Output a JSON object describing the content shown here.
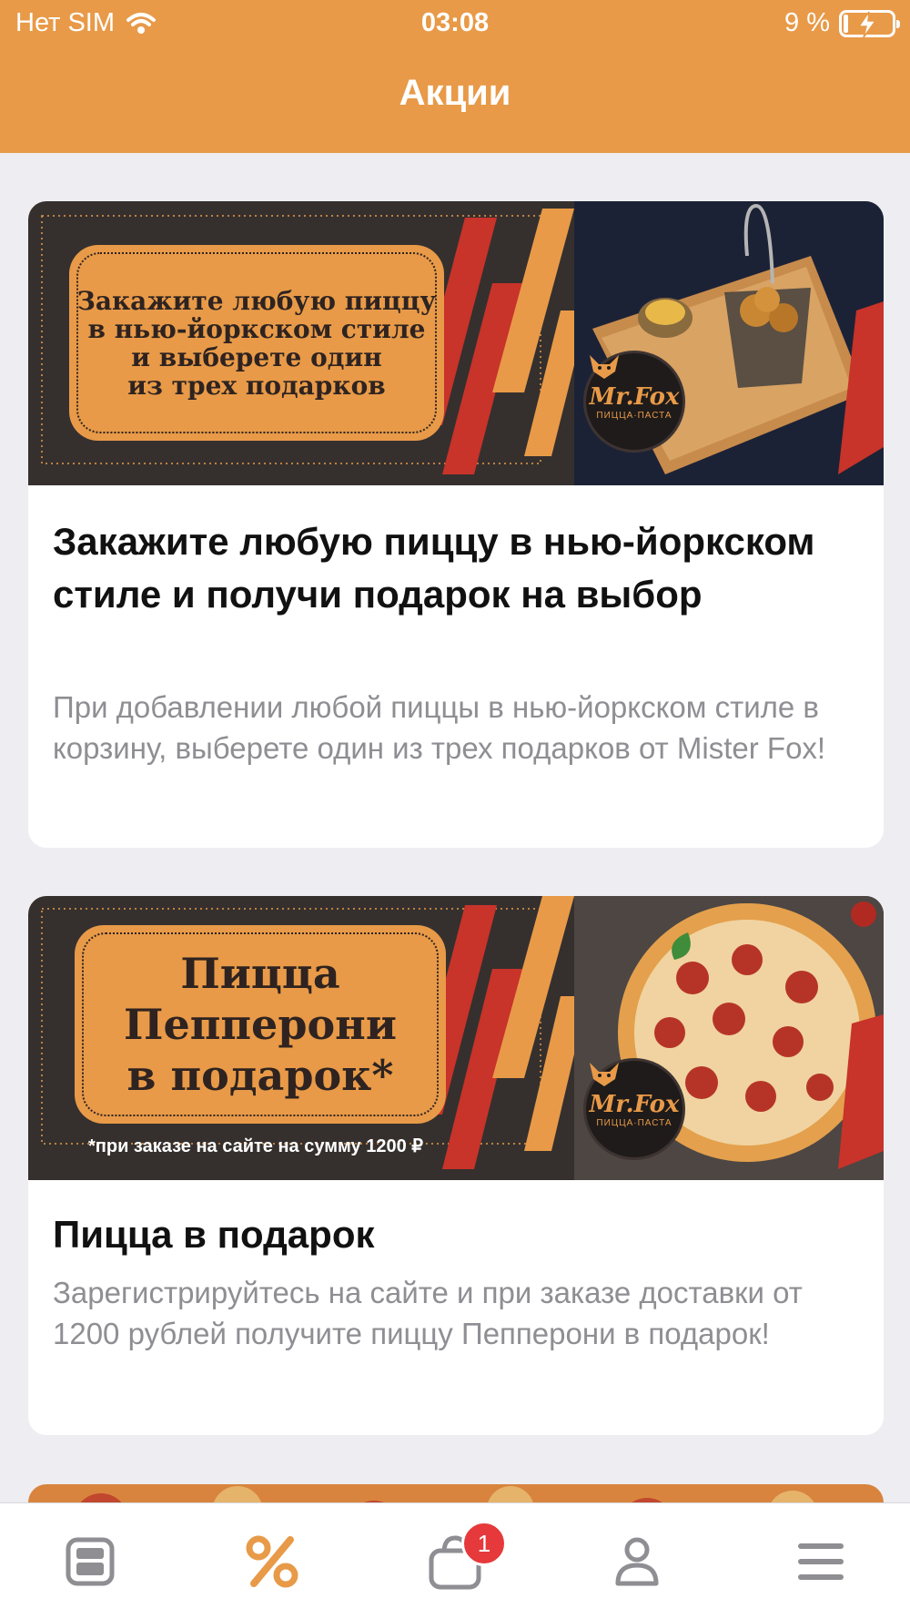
{
  "status_bar": {
    "carrier": "Нет SIM",
    "time": "03:08",
    "battery": "9 %"
  },
  "header": {
    "title": "Акции"
  },
  "promotions": [
    {
      "banner_text_lines": [
        "Закажите любую пиццу",
        "в нью-йоркском стиле",
        "и выберете один",
        "из трех подарков"
      ],
      "logo_text": "Mr.Fox",
      "logo_sub": "ПИЦЦА·ПАСТА",
      "title": "Закажите любую пиццу в нью-йоркском стиле и получи подарок на выбор",
      "description": "При добавлении любой пиццы в нью-йоркском стиле в корзину, выберете один из трех подарков от Mister Fox!"
    },
    {
      "banner_text_lines": [
        "Пицца",
        "Пепперони",
        "в подарок*"
      ],
      "banner_footnote": "*при заказе на сайте на сумму 1200 ₽",
      "logo_text": "Mr.Fox",
      "logo_sub": "ПИЦЦА·ПАСТА",
      "title": "Пицца в подарок",
      "description": "Зарегистрируйтесь на сайте и при заказе доставки от 1200 рублей получите пиццу Пепперони в подарок!"
    }
  ],
  "tab_bar": {
    "items": [
      {
        "icon": "menu-card-icon"
      },
      {
        "icon": "percent-icon",
        "active": true
      },
      {
        "icon": "basket-icon",
        "badge": "1"
      },
      {
        "icon": "profile-icon"
      },
      {
        "icon": "hamburger-menu-icon"
      }
    ]
  },
  "colors": {
    "accent": "#e89a48",
    "banner_dark": "#35302e",
    "banner_red": "#c8332a",
    "badge": "#e5393b"
  }
}
